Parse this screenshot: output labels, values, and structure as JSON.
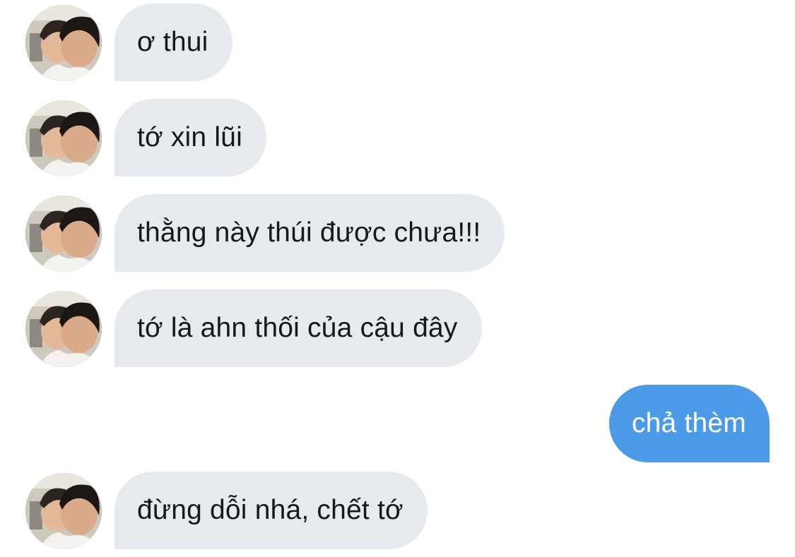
{
  "conversation": {
    "messages": [
      {
        "sender": "other",
        "text": "ơ thui",
        "avatar_icon": "profile-photo-icon"
      },
      {
        "sender": "other",
        "text": "tớ xin lũi",
        "avatar_icon": "profile-photo-icon"
      },
      {
        "sender": "other",
        "text": "thằng này thúi được chưa!!!",
        "avatar_icon": "profile-photo-icon"
      },
      {
        "sender": "other",
        "text": "tớ là ahn thối của cậu đây",
        "avatar_icon": "profile-photo-icon"
      },
      {
        "sender": "me",
        "text": "chả thèm"
      },
      {
        "sender": "other",
        "text": "đừng dỗi nhá, chết tớ",
        "avatar_icon": "profile-photo-icon"
      }
    ]
  },
  "colors": {
    "incoming_bubble": "#e6e9ee",
    "outgoing_bubble": "#4c9be8",
    "incoming_text": "#16181c",
    "outgoing_text": "#ffffff",
    "background": "#ffffff"
  }
}
